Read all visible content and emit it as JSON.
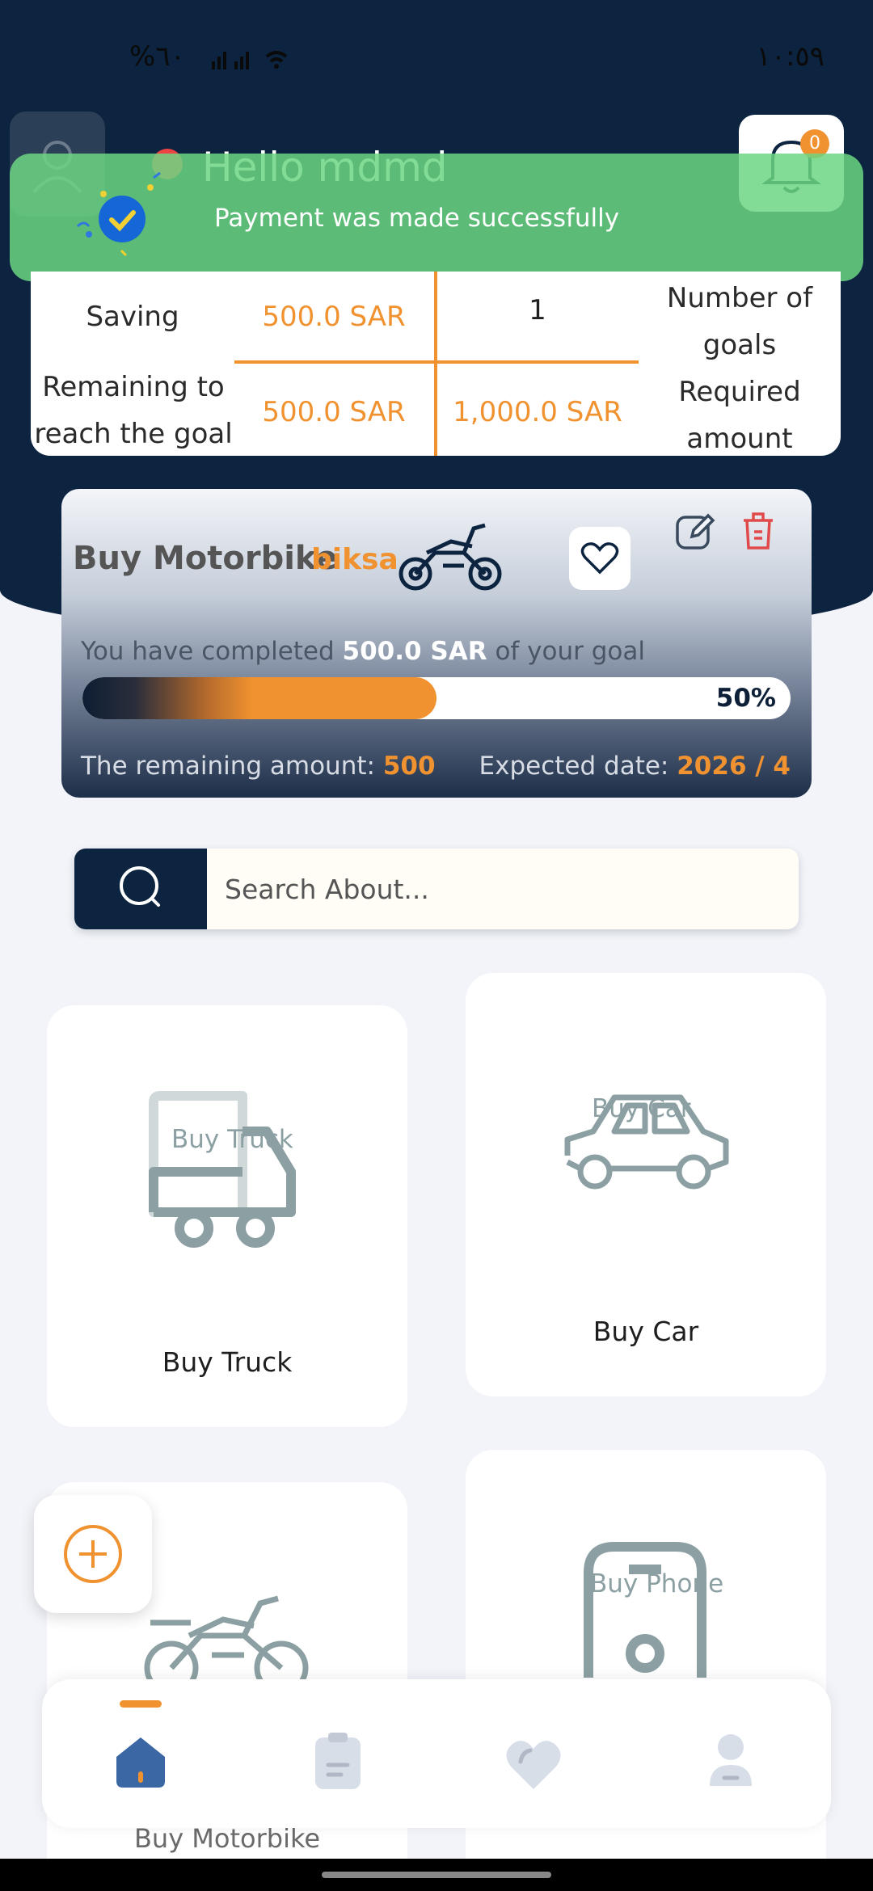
{
  "status_bar": {
    "left_text": "%٦٠",
    "right_time": "١٠:٥٩"
  },
  "header": {
    "greeting": "Hello mdmd",
    "notification_count": "0"
  },
  "toast": {
    "message": "Payment was made successfully"
  },
  "stats": {
    "saving_label": "Saving",
    "saving_value": "500.0 SAR",
    "goals_count": "1",
    "goals_label": "Number of goals",
    "remaining_label": "Remaining to reach the goal",
    "remaining_value": "500.0 SAR",
    "required_value": "1,000.0 SAR",
    "required_label": "Required amount"
  },
  "goal": {
    "title": "Buy Motorbike",
    "tag": "biksa",
    "completed_prefix": "You have completed",
    "completed_amount": "500.0 SAR",
    "completed_suffix": "of your goal",
    "progress_fraction": 0.5,
    "progress_text": "50%",
    "remaining_label": "The remaining amount:",
    "remaining_value": "500",
    "expected_label": "Expected date:",
    "expected_value": "2026 / 4"
  },
  "search": {
    "placeholder": "Search About..."
  },
  "categories": [
    {
      "label": "Buy Truck",
      "ghost": "Buy Truck"
    },
    {
      "label": "Buy Car",
      "ghost": "Buy Car"
    },
    {
      "label": "Buy Motorbike",
      "ghost": ""
    },
    {
      "label": "",
      "ghost": "Buy Phone"
    }
  ],
  "colors": {
    "primary": "#0C2440",
    "accent": "#F0922F",
    "toast": "#6CD682",
    "icon_gray": "#8CA0A3"
  }
}
